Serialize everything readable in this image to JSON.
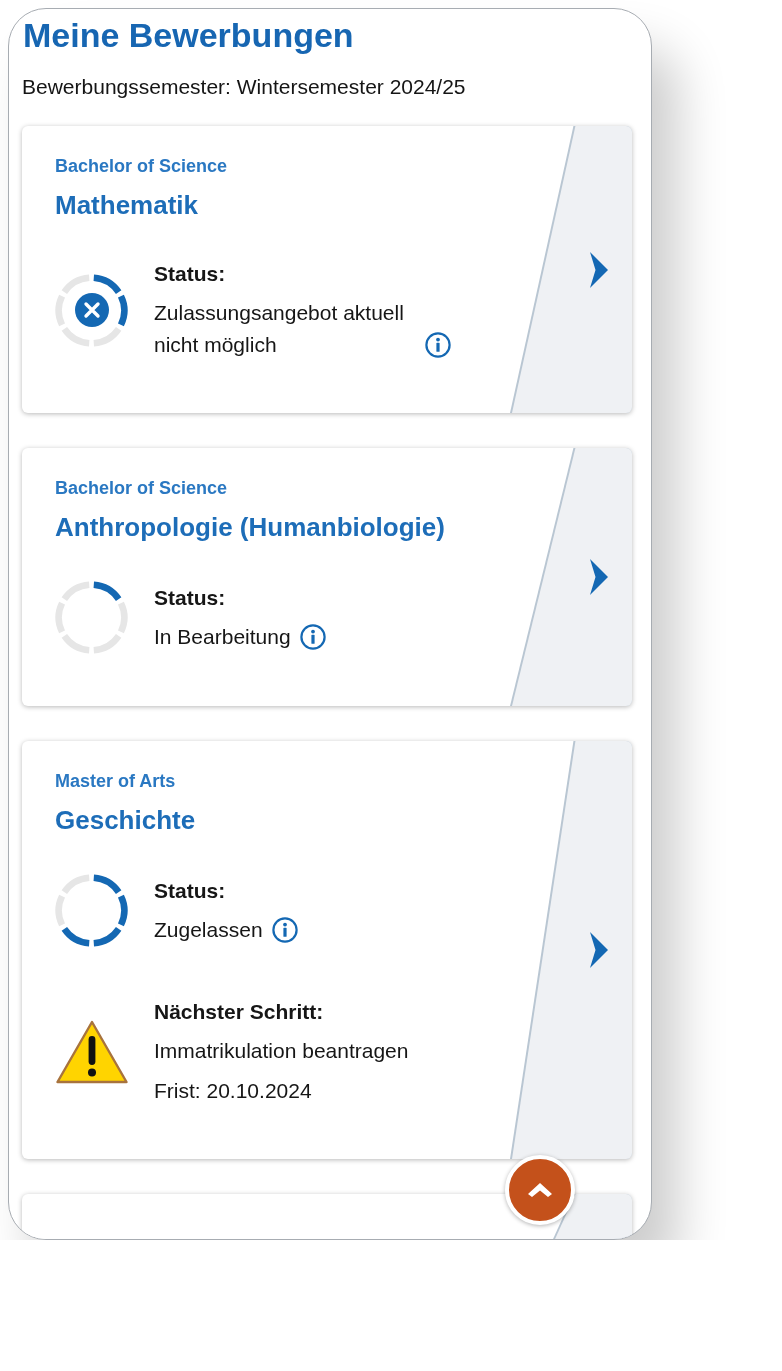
{
  "page": {
    "title": "Meine Bewerbungen",
    "semester": "Bewerbungssemester: Wintersemester 2024/25"
  },
  "applications": [
    {
      "degree": "Bachelor of Science",
      "subject": "Mathematik",
      "status": {
        "label": "Status:",
        "text": "Zulassungsangebot aktuell nicht möglich",
        "kind": "rejected",
        "level": 0.33
      }
    },
    {
      "degree": "Bachelor of Science",
      "subject": "Anthropologie (Humanbiologie)",
      "status": {
        "label": "Status:",
        "text": "In Bearbeitung",
        "kind": "in_progress",
        "level": 0.17
      }
    },
    {
      "degree": "Master of Arts",
      "subject": "Geschichte",
      "status": {
        "label": "Status:",
        "text": "Zugelassen",
        "kind": "admitted",
        "level": 0.67
      },
      "next_step": {
        "label": "Nächster Schritt:",
        "action": "Immatrikulation beantragen",
        "deadline": "Frist: 20.10.2024",
        "kind": "warning"
      }
    }
  ],
  "more_applications_below": true,
  "scroll_top_button": {
    "visible": true
  }
}
